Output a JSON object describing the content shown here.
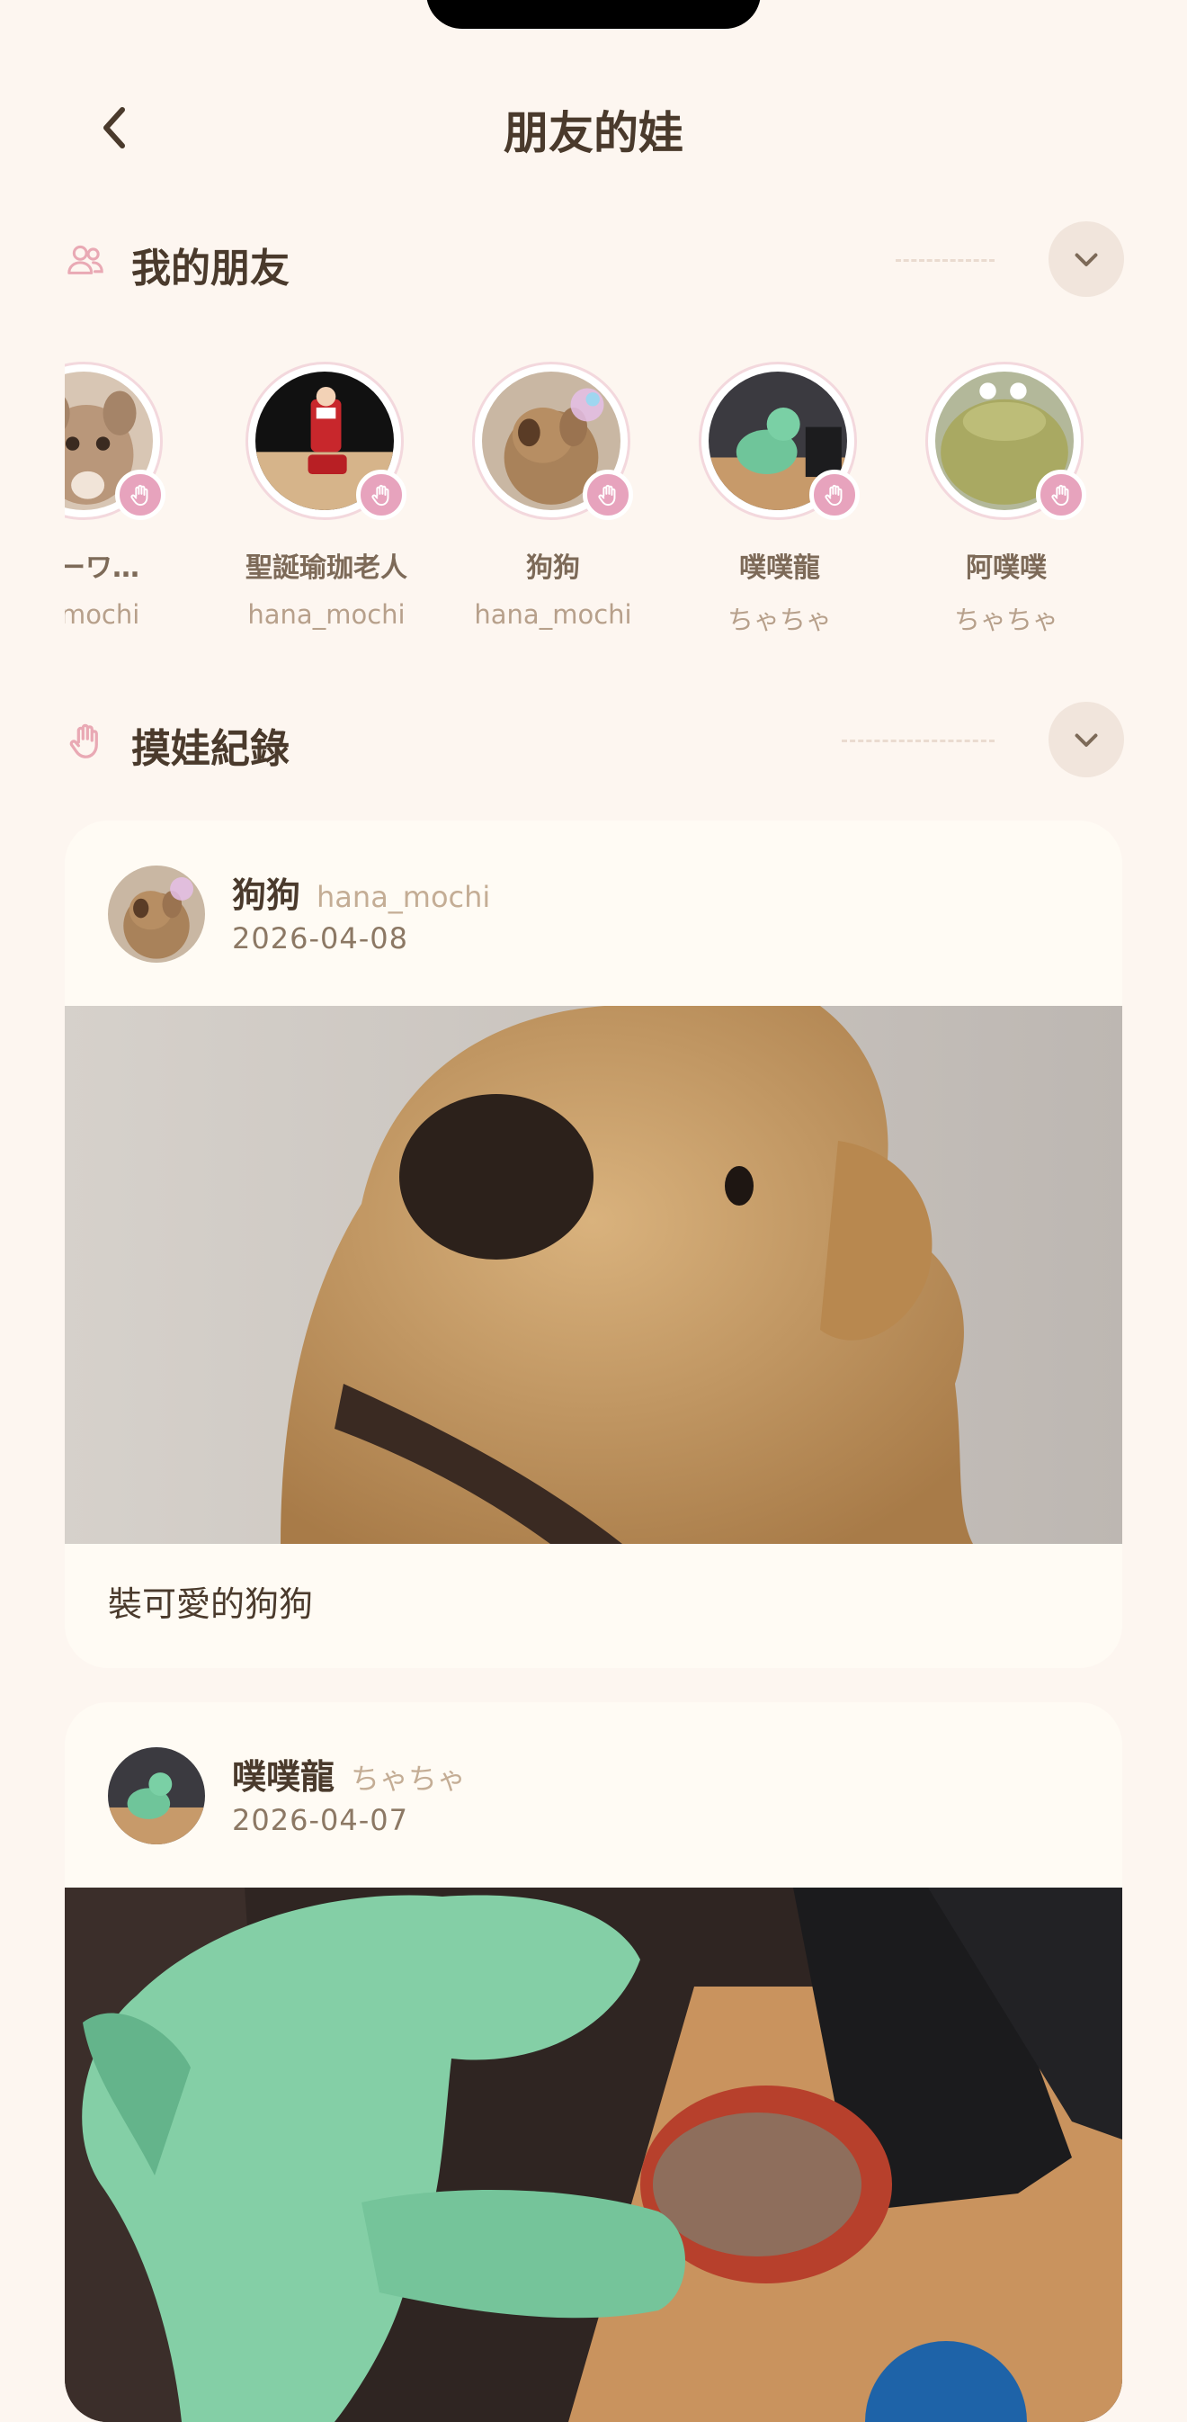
{
  "header": {
    "title": "朋友的娃"
  },
  "friends_section": {
    "title": "我的朋友",
    "friends": [
      {
        "name": "トーワ…",
        "owner": "a_mochi"
      },
      {
        "name": "聖誕瑜珈老人",
        "owner": "hana_mochi"
      },
      {
        "name": "狗狗",
        "owner": "hana_mochi"
      },
      {
        "name": "噗噗龍",
        "owner": "ちゃちゃ"
      },
      {
        "name": "阿噗噗",
        "owner": "ちゃちゃ"
      }
    ]
  },
  "records_section": {
    "title": "摸娃紀錄"
  },
  "posts": [
    {
      "name": "狗狗",
      "owner": "hana_mochi",
      "date": "2026-04-08",
      "caption": "裝可愛的狗狗"
    },
    {
      "name": "噗噗龍",
      "owner": "ちゃちゃ",
      "date": "2026-04-07",
      "caption": ""
    }
  ],
  "colors": {
    "background": "#fdf6f0",
    "card": "#fffbf4",
    "accent_pink": "#e7a3bd",
    "text_dark": "#4a3a2c",
    "text_muted": "#b7a08b"
  },
  "icons": [
    "chevron-left-icon",
    "people-icon",
    "chevron-down-icon",
    "hand-icon"
  ]
}
